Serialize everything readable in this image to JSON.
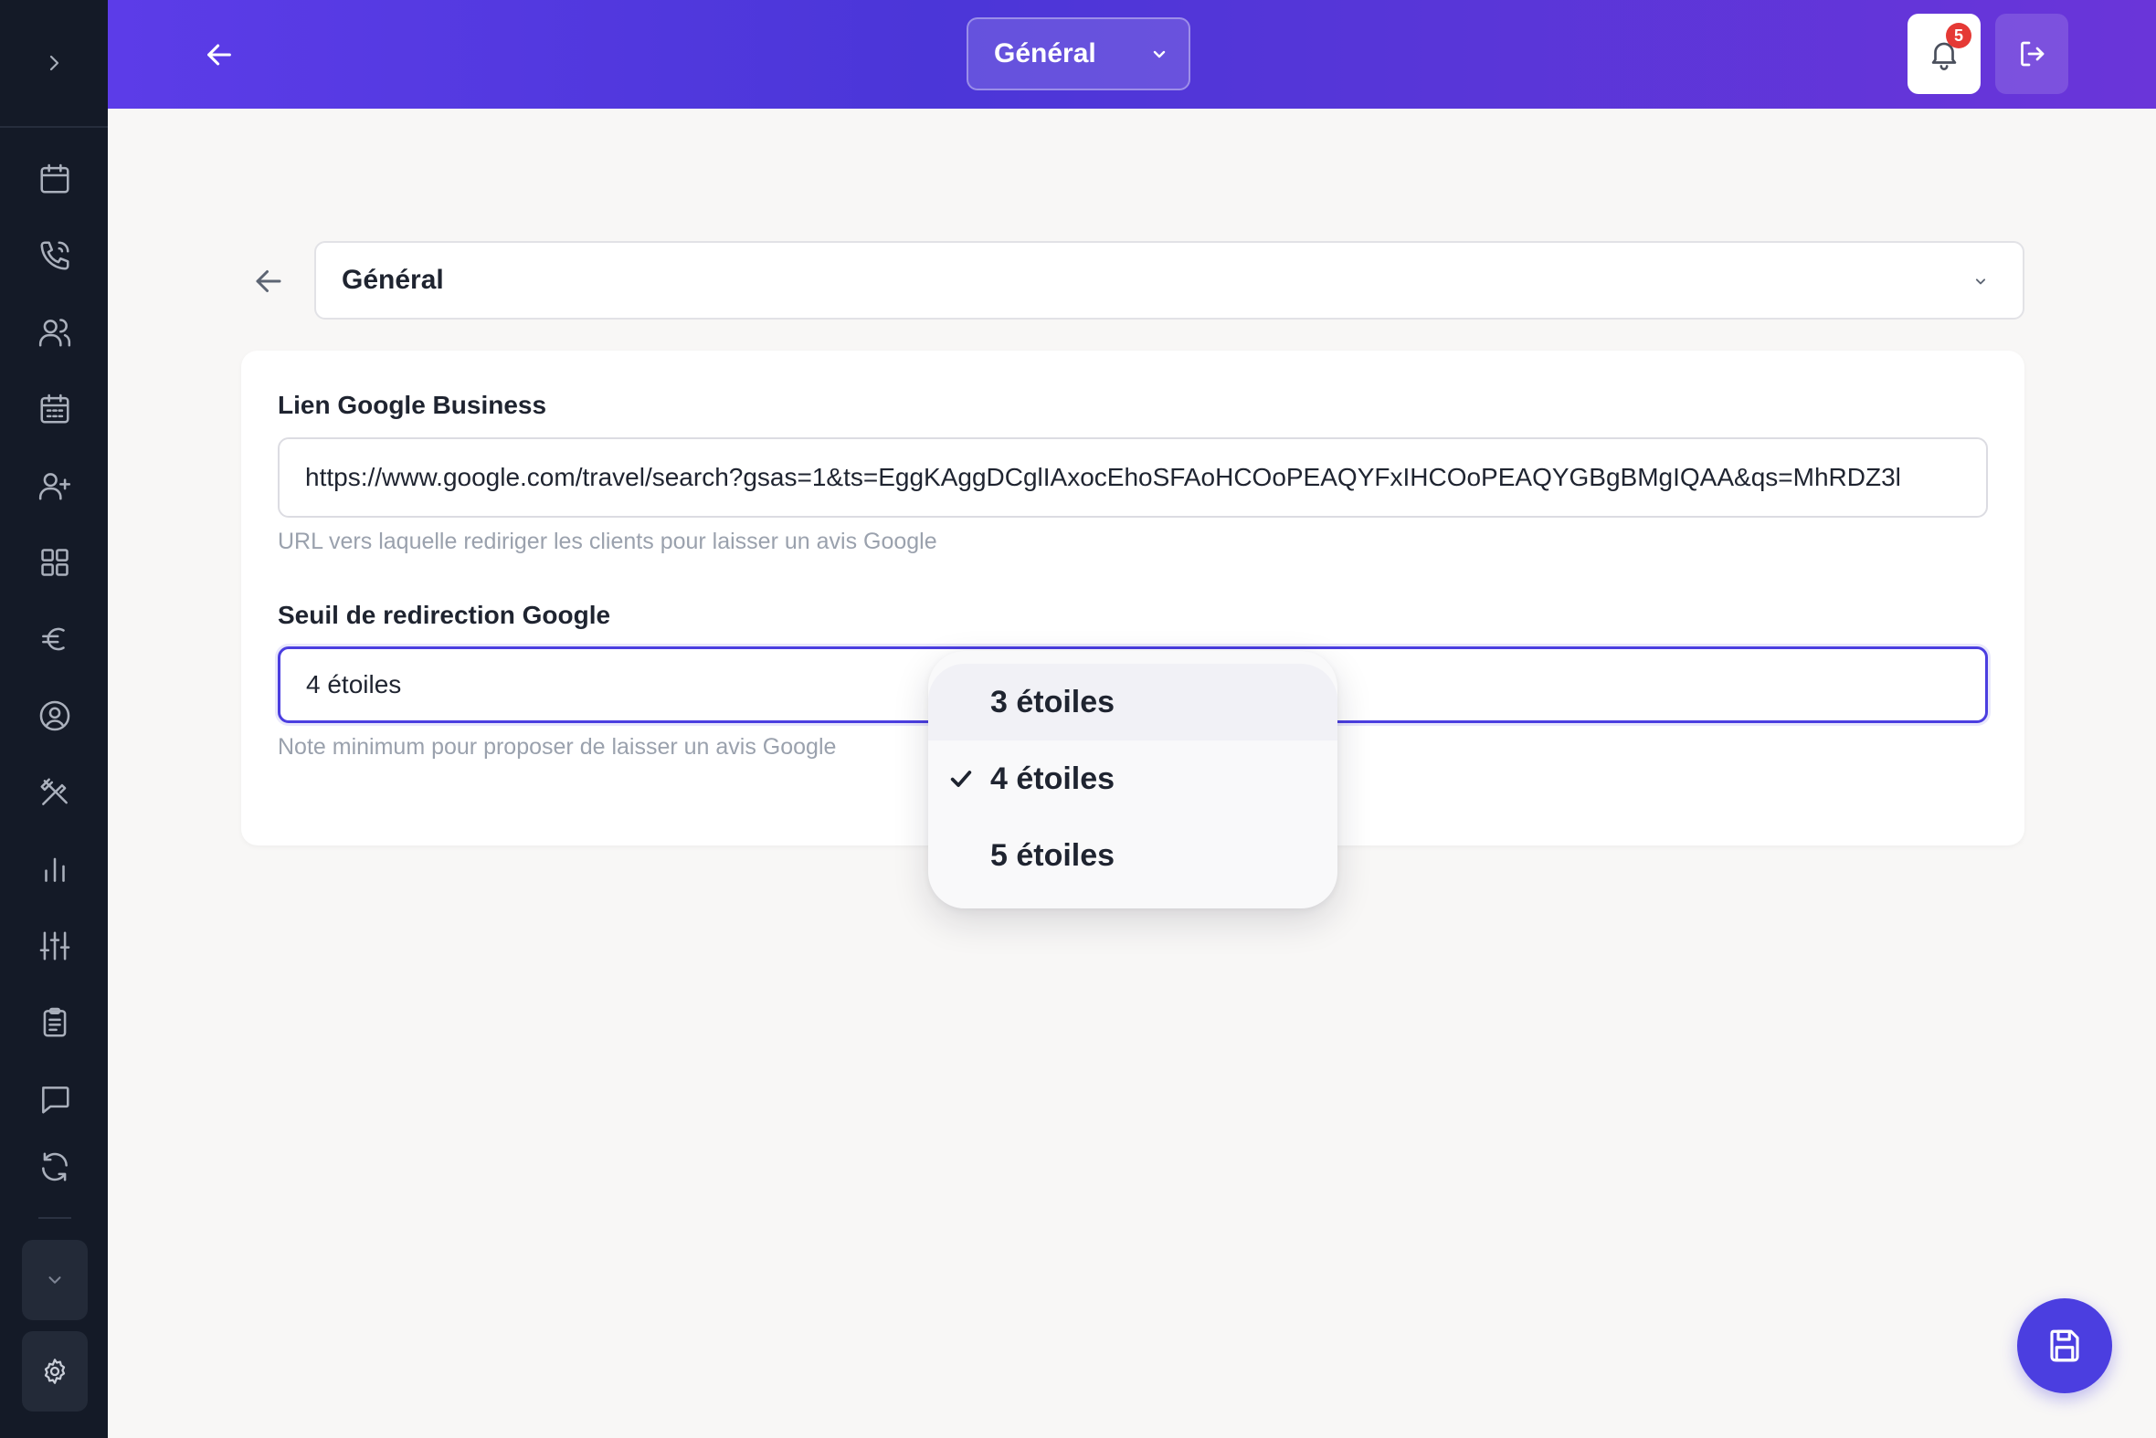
{
  "header": {
    "section_select": {
      "value": "Général"
    },
    "notifications": {
      "count": "5"
    }
  },
  "sidebar": {
    "items": [
      "calendar-icon",
      "phone-icon",
      "users-icon",
      "calendar-grid-icon",
      "user-plus-icon",
      "apps-grid-icon",
      "euro-icon",
      "user-circle-icon",
      "utensils-icon",
      "bar-chart-icon",
      "sliders-icon",
      "clipboard-icon",
      "message-icon",
      "refresh-icon"
    ]
  },
  "page": {
    "section_select": {
      "value": "Général"
    }
  },
  "form": {
    "google_link": {
      "label": "Lien Google Business",
      "value": "https://www.google.com/travel/search?gsas=1&ts=EggKAggDCglIAxocEhoSFAoHCOoPEAQYFxIHCOoPEAQYGBgBMgIQAA&qs=MhRDZ3l",
      "hint": "URL vers laquelle rediriger les clients pour laisser un avis Google"
    },
    "google_threshold": {
      "label": "Seuil de redirection Google",
      "value": "4 étoiles",
      "hint": "Note minimum pour proposer de laisser un avis Google"
    }
  },
  "dropdown": {
    "options": [
      {
        "label": "3 étoiles",
        "selected": false
      },
      {
        "label": "4 étoiles",
        "selected": true
      },
      {
        "label": "5 étoiles",
        "selected": false
      }
    ]
  },
  "colors": {
    "accent": "#4b3ee0",
    "sidebar_bg": "#141a27",
    "header_gradient_start": "#5c3ce8",
    "header_gradient_end": "#6a35d9",
    "badge": "#e53935"
  }
}
